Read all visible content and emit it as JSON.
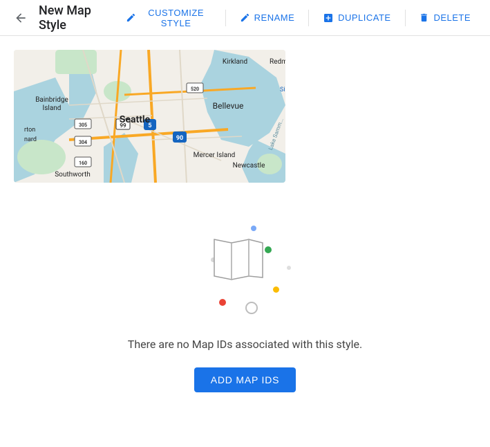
{
  "toolbar": {
    "title": "New Map Style",
    "back_icon": "←",
    "actions": [
      {
        "id": "customize",
        "label": "CUSTOMIZE STYLE",
        "icon": "pencil"
      },
      {
        "id": "rename",
        "label": "RENAME",
        "icon": "pencil"
      },
      {
        "id": "duplicate",
        "label": "DUPLICATE",
        "icon": "plus-box"
      },
      {
        "id": "delete",
        "label": "DELETE",
        "icon": "trash"
      }
    ]
  },
  "empty_state": {
    "message": "There are no Map IDs associated with this style.",
    "add_button_label": "ADD MAP IDS"
  },
  "colors": {
    "primary": "#1a73e8",
    "water": "#aad3df",
    "land": "#f2efe9",
    "green": "#c8e6c9",
    "road": "#f9a825",
    "dot_blue": "#4285f4",
    "dot_green": "#34a853",
    "dot_yellow": "#fbbc04",
    "dot_red": "#ea4335",
    "dot_gray": "#bdbdbd"
  }
}
